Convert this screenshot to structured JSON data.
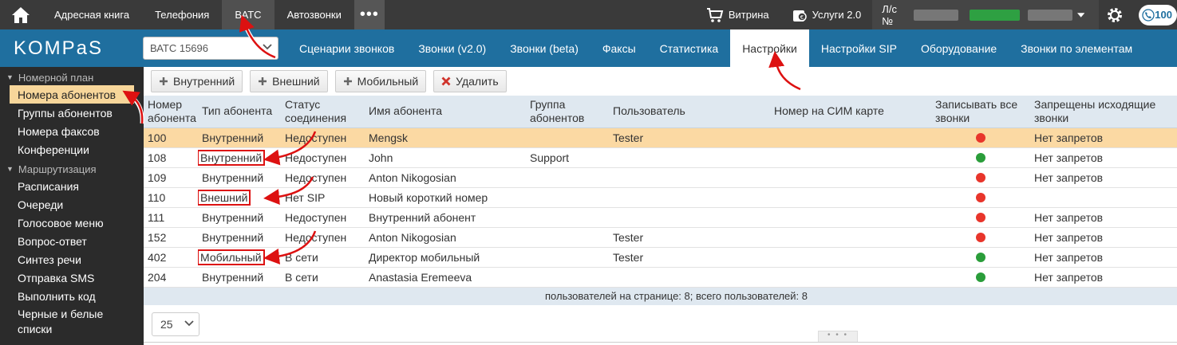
{
  "topbar": {
    "nav": [
      "Адресная книга",
      "Телефония",
      "ВАТС",
      "Автозвонки"
    ],
    "active": "ВАТС",
    "more": "•••",
    "vitrina": "Витрина",
    "services": "Услуги 2.0",
    "account_label": "Л/с №",
    "balance": "100"
  },
  "logo": "KOMPaS",
  "vats_select": {
    "value": "ВАТС 15696"
  },
  "subnav": [
    "Сценарии звонков",
    "Звонки (v2.0)",
    "Звонки (beta)",
    "Факсы",
    "Статистика",
    "Настройки",
    "Настройки SIP",
    "Оборудование",
    "Звонки по элементам"
  ],
  "subnav_active": "Настройки",
  "sidebar": {
    "section1": "Номерной план",
    "items1": [
      "Номера абонентов",
      "Группы абонентов",
      "Номера факсов",
      "Конференции"
    ],
    "section2": "Маршрутизация",
    "items2": [
      "Расписания",
      "Очереди",
      "Голосовое меню",
      "Вопрос-ответ",
      "Синтез речи",
      "Отправка SMS",
      "Выполнить код",
      "Черные и белые списки"
    ]
  },
  "toolbar": {
    "internal": "Внутренний",
    "external": "Внешний",
    "mobile": "Мобильный",
    "delete": "Удалить"
  },
  "table": {
    "headers": {
      "number": "Номер абонента",
      "type": "Тип абонента",
      "status": "Статус соединения",
      "name": "Имя абонента",
      "group": "Группа абонентов",
      "user": "Пользователь",
      "sim": "Номер на СИМ карте",
      "record": "Записывать все звонки",
      "restrict": "Запрещены исходящие звонки"
    },
    "rows": [
      {
        "number": "100",
        "type": "Внутренний",
        "status": "Недоступен",
        "name": "Mengsk",
        "group": "",
        "user": "Tester",
        "sim": "",
        "record": "red",
        "restrict": "Нет запретов"
      },
      {
        "number": "108",
        "type": "Внутренний",
        "status": "Недоступен",
        "name": "John",
        "group": "Support",
        "user": "",
        "sim": "",
        "record": "green",
        "restrict": "Нет запретов"
      },
      {
        "number": "109",
        "type": "Внутренний",
        "status": "Недоступен",
        "name": "Anton Nikogosian",
        "group": "",
        "user": "",
        "sim": "",
        "record": "red",
        "restrict": "Нет запретов"
      },
      {
        "number": "110",
        "type": "Внешний",
        "status": "Нет SIP",
        "name": "Новый короткий номер",
        "group": "",
        "user": "",
        "sim": "",
        "record": "red",
        "restrict": ""
      },
      {
        "number": "111",
        "type": "Внутренний",
        "status": "Недоступен",
        "name": "Внутренний абонент",
        "group": "",
        "user": "",
        "sim": "",
        "record": "red",
        "restrict": "Нет запретов"
      },
      {
        "number": "152",
        "type": "Внутренний",
        "status": "Недоступен",
        "name": "Anton Nikogosian",
        "group": "",
        "user": "Tester",
        "sim": "",
        "record": "red",
        "restrict": "Нет запретов"
      },
      {
        "number": "402",
        "type": "Мобильный",
        "status": "В сети",
        "name": "Директор мобильный",
        "group": "",
        "user": "Tester",
        "sim": "",
        "record": "green",
        "restrict": "Нет запретов"
      },
      {
        "number": "204",
        "type": "Внутренний",
        "status": "В сети",
        "name": "Anastasia Eremeeva",
        "group": "",
        "user": "",
        "sim": "",
        "record": "green",
        "restrict": "Нет запретов"
      }
    ],
    "footer": "пользователей на странице: 8; всего пользователей: 8"
  },
  "pager": {
    "page_size": "25"
  },
  "colors": {
    "topbar": "#3a3a3a",
    "brand_blue": "#1f6f9f",
    "selected_row": "#fbd9a3",
    "record_on": "#2a9d3a",
    "record_off": "#e8352b"
  }
}
